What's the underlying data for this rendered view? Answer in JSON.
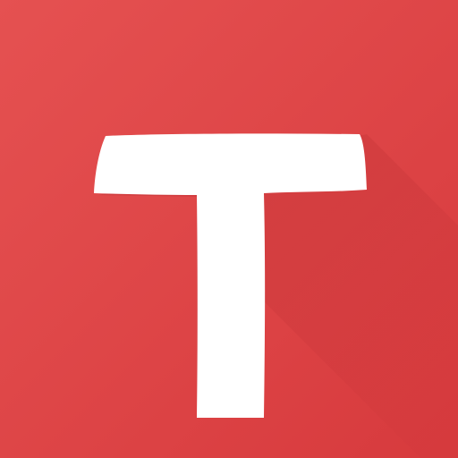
{
  "logo": {
    "letter": "T",
    "icon": "letter-t-logo-icon",
    "colors": {
      "background": "#e04444",
      "background_light": "#e55151",
      "background_dark": "#d73a3d",
      "shadow": "#c23236",
      "glyph": "#ffffff"
    }
  }
}
